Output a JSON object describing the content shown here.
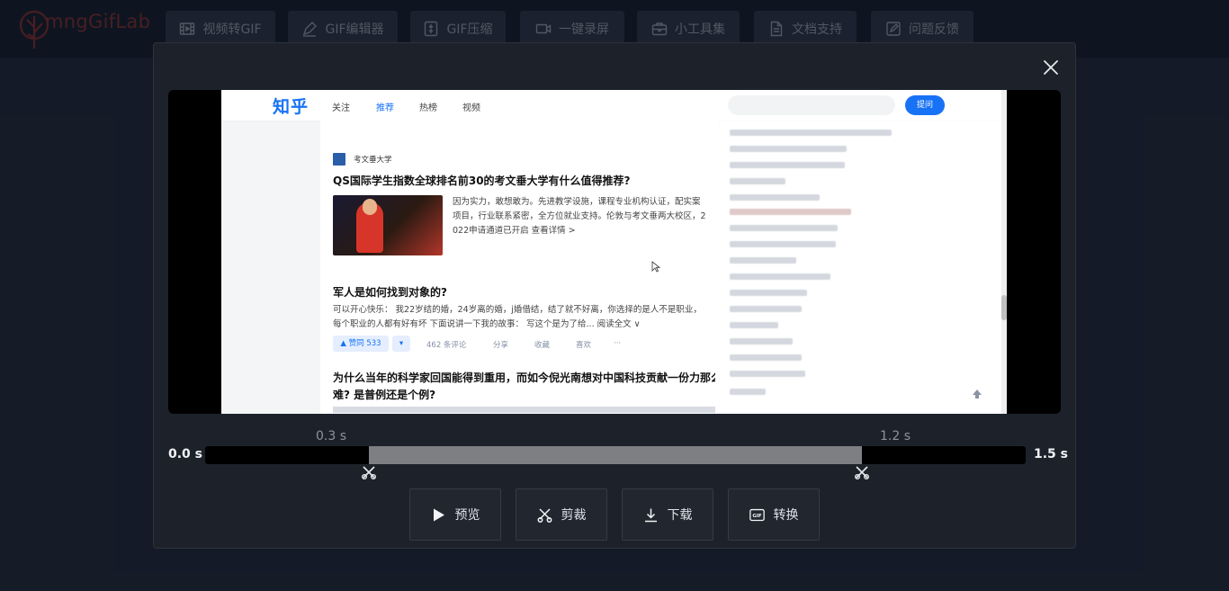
{
  "app": {
    "logo_text": "mngGifLab"
  },
  "nav": [
    {
      "label": "视频转GIF",
      "icon": "film-icon"
    },
    {
      "label": "GIF编辑器",
      "icon": "pen-icon"
    },
    {
      "label": "GIF压缩",
      "icon": "compress-icon"
    },
    {
      "label": "一键录屏",
      "icon": "camera-icon"
    },
    {
      "label": "小工具集",
      "icon": "toolbox-icon"
    },
    {
      "label": "文档支持",
      "icon": "document-icon"
    },
    {
      "label": "问题反馈",
      "icon": "feedback-icon"
    }
  ],
  "modal": {
    "close_icon": "close-icon",
    "preview": {
      "site_logo": "知乎",
      "tabs": [
        "关注",
        "推荐",
        "热榜",
        "视频"
      ],
      "active_tab": "推荐",
      "ask_button": "提问",
      "posts": [
        {
          "author": "考文垂大学",
          "title": "QS国际学生指数全球排名前30的考文垂大学有什么值得推荐?",
          "text_lines": [
            "因为实力，敢想敢为。先进教学设施，课程专业机构认证，配实案",
            "项目，行业联系紧密，全方位就业支持。伦敦与考文垂两大校区，2",
            "022申请通道已开启 查看详情 >"
          ]
        },
        {
          "title": "军人是如何找到对象的?",
          "text_lines": [
            "可以开心快乐： 我22岁结的婚，24岁离的婚，j婚借结，结了就不好离，你选择的是人不是职业，",
            "每个职业的人都有好有坏 下面说讲一下我的故事： 写这个是为了给... 阅读全文 ∨"
          ],
          "vote": "▲ 赞同 533",
          "meta": [
            "462 条评论",
            "分享",
            "收藏",
            "喜欢",
            "···"
          ]
        },
        {
          "title_lines": [
            "为什么当年的科学家回国能得到重用，而如今倪光南想对中国科技贡献一份力那么",
            "难? 是普例还是个例?"
          ]
        }
      ]
    },
    "timeline": {
      "start_label": "0.0 s",
      "end_label": "1.5 s",
      "sel_start_label": "0.3 s",
      "sel_end_label": "1.2 s",
      "duration": 1.5,
      "sel_start": 0.3,
      "sel_end": 1.2
    },
    "actions": [
      {
        "label": "预览",
        "icon": "play-icon"
      },
      {
        "label": "剪裁",
        "icon": "scissors-icon"
      },
      {
        "label": "下载",
        "icon": "download-icon"
      },
      {
        "label": "转换",
        "icon": "gif-icon"
      }
    ]
  }
}
